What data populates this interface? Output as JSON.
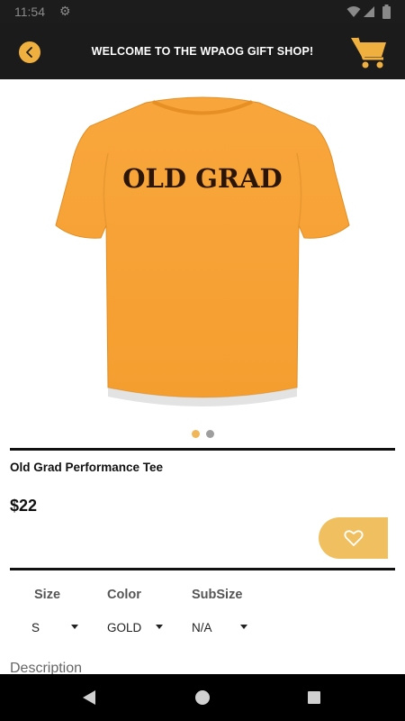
{
  "status_bar": {
    "time": "11:54"
  },
  "header": {
    "title": "WELCOME TO THE WPAOG GIFT SHOP!",
    "back_icon": "chevron-left-icon",
    "cart_icon": "shopping-cart-icon"
  },
  "product": {
    "image_text": "OLD GRAD",
    "name": "Old Grad Performance Tee",
    "price": "$22",
    "carousel": {
      "total": 2,
      "active_index": 0
    }
  },
  "options": [
    {
      "label": "Size",
      "value": "S"
    },
    {
      "label": "Color",
      "value": "GOLD"
    },
    {
      "label": "SubSize",
      "value": "N/A"
    }
  ],
  "description": {
    "heading": "Description"
  },
  "colors": {
    "accent": "#F0B040",
    "favorite_button": "#F0C060",
    "shirt": "#F7A23A",
    "header_bg": "#1B1B1B"
  }
}
